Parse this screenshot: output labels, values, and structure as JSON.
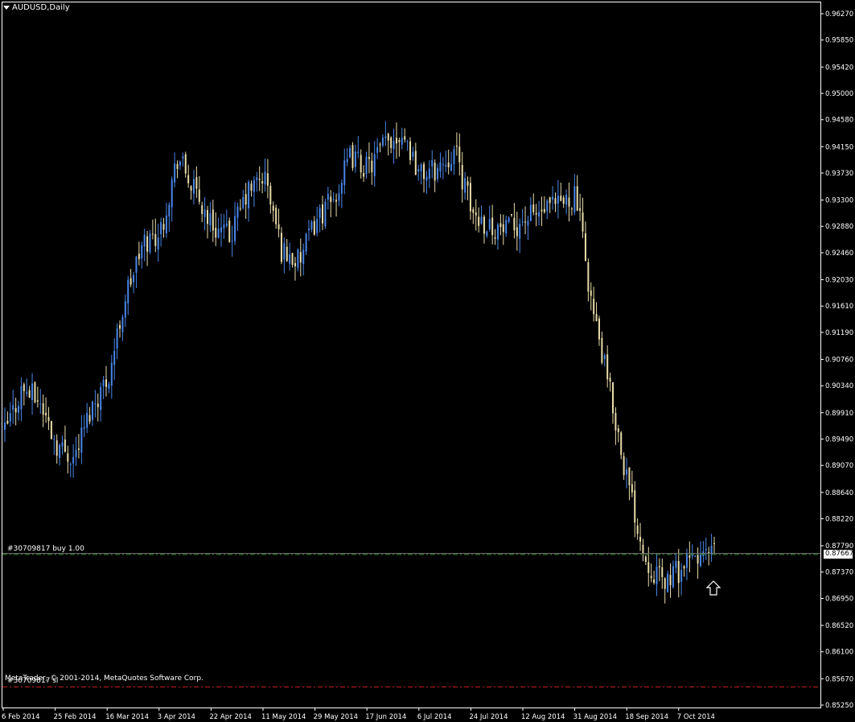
{
  "window": {
    "title": "AUDUSD,Daily"
  },
  "footer": {
    "copyright": "MetaTrader, © 2001-2014, MetaQuotes Software Corp."
  },
  "orders": {
    "buy_label": "#30709817 buy 1.00",
    "sl_label": "#30709817 sl",
    "buy_price": 0.8765,
    "sl_price": 0.8554
  },
  "current_price_label": "0.87667",
  "colors": {
    "background": "#000000",
    "bull": "#4a86e8",
    "bear": "#e8dcaa",
    "buy_line": "#2e8b2e",
    "sl_line": "#d42020",
    "axis": "#ffffff"
  },
  "icons": {
    "arrow_marker": "up-arrow-icon"
  },
  "chart_data": {
    "type": "candlestick",
    "symbol": "AUDUSD",
    "timeframe": "Daily",
    "ylim": [
      0.8525,
      0.9627
    ],
    "y_ticks": [
      "0.96270",
      "0.95850",
      "0.95420",
      "0.95000",
      "0.94580",
      "0.94150",
      "0.93730",
      "0.93300",
      "0.92880",
      "0.92460",
      "0.92030",
      "0.91610",
      "0.91190",
      "0.90760",
      "0.90340",
      "0.89910",
      "0.89490",
      "0.89070",
      "0.88640",
      "0.88220",
      "0.87790",
      "0.87370",
      "0.86950",
      "0.86520",
      "0.86100",
      "0.85670",
      "0.85250"
    ],
    "x_ticks": [
      "6 Feb 2014",
      "25 Feb 2014",
      "16 Mar 2014",
      "3 Apr 2014",
      "22 Apr 2014",
      "11 May 2014",
      "29 May 2014",
      "17 Jun 2014",
      "6 Jul 2014",
      "24 Jul 2014",
      "12 Aug 2014",
      "31 Aug 2014",
      "18 Sep 2014",
      "7 Oct 2014"
    ],
    "close_path": [
      [
        "6 Feb 2014",
        0.896
      ],
      [
        "12 Feb 2014",
        0.903
      ],
      [
        "18 Feb 2014",
        0.901
      ],
      [
        "25 Feb 2014",
        0.894
      ],
      [
        "2 Mar 2014",
        0.892
      ],
      [
        "8 Mar 2014",
        0.9
      ],
      [
        "16 Mar 2014",
        0.905
      ],
      [
        "22 Mar 2014",
        0.918
      ],
      [
        "28 Mar 2014",
        0.926
      ],
      [
        "3 Apr 2014",
        0.928
      ],
      [
        "9 Apr 2014",
        0.94
      ],
      [
        "15 Apr 2014",
        0.934
      ],
      [
        "22 Apr 2014",
        0.929
      ],
      [
        "28 Apr 2014",
        0.927
      ],
      [
        "4 May 2014",
        0.934
      ],
      [
        "11 May 2014",
        0.937
      ],
      [
        "17 May 2014",
        0.925
      ],
      [
        "23 May 2014",
        0.923
      ],
      [
        "29 May 2014",
        0.93
      ],
      [
        "4 Jun 2014",
        0.933
      ],
      [
        "10 Jun 2014",
        0.94
      ],
      [
        "17 Jun 2014",
        0.938
      ],
      [
        "23 Jun 2014",
        0.942
      ],
      [
        "29 Jun 2014",
        0.944
      ],
      [
        "6 Jul 2014",
        0.937
      ],
      [
        "12 Jul 2014",
        0.938
      ],
      [
        "18 Jul 2014",
        0.941
      ],
      [
        "24 Jul 2014",
        0.931
      ],
      [
        "30 Jul 2014",
        0.929
      ],
      [
        "5 Aug 2014",
        0.928
      ],
      [
        "12 Aug 2014",
        0.93
      ],
      [
        "18 Aug 2014",
        0.931
      ],
      [
        "24 Aug 2014",
        0.932
      ],
      [
        "31 Aug 2014",
        0.934
      ],
      [
        "6 Sep 2014",
        0.915
      ],
      [
        "12 Sep 2014",
        0.902
      ],
      [
        "18 Sep 2014",
        0.888
      ],
      [
        "24 Sep 2014",
        0.876
      ],
      [
        "30 Sep 2014",
        0.872
      ],
      [
        "7 Oct 2014",
        0.874
      ],
      [
        "13 Oct 2014",
        0.876
      ],
      [
        "18 Oct 2014",
        0.8766
      ]
    ]
  }
}
